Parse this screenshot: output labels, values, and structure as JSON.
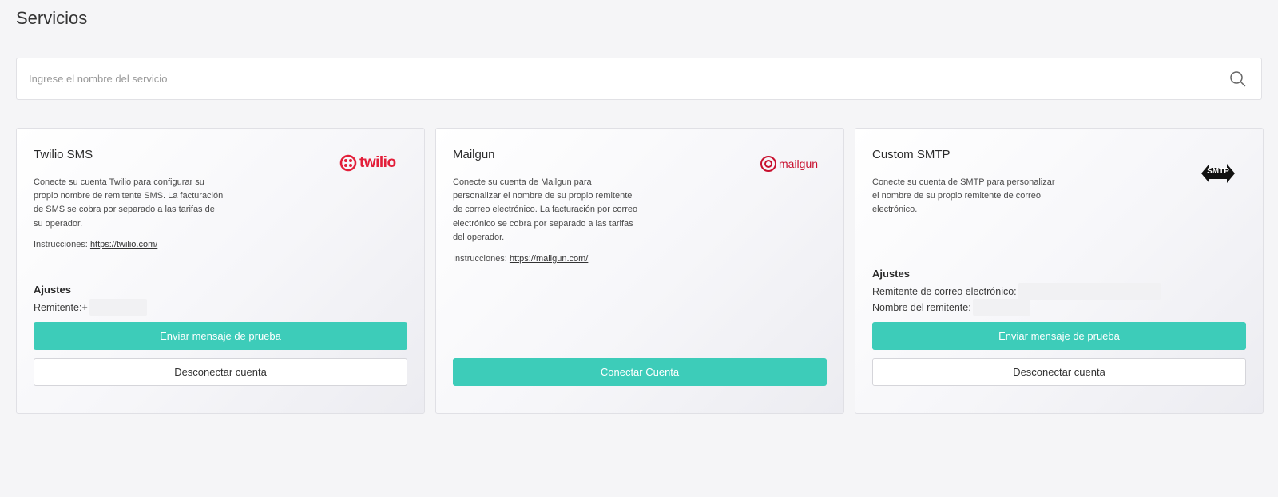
{
  "page": {
    "title": "Servicios"
  },
  "search": {
    "placeholder": "Ingrese el nombre del servicio"
  },
  "colors": {
    "accent": "#3dccb9",
    "twilio": "#e31e39",
    "mailgun": "#c8102e"
  },
  "cards": [
    {
      "title": "Twilio SMS",
      "logo_text": "twilio",
      "logo_icon": "twilio-logo",
      "description": "Conecte su cuenta Twilio para configurar su propio nombre de remitente SMS. La facturación de SMS se cobra por separado a las tarifas de su operador.",
      "instructions_label": "Instrucciones:",
      "instructions_link": "https://twilio.com/",
      "settings_title": "Ajustes",
      "settings": [
        {
          "label": "Remitente:",
          "value": "+"
        }
      ],
      "buttons": [
        "Enviar mensaje de prueba",
        "Desconectar cuenta"
      ]
    },
    {
      "title": "Mailgun",
      "logo_text": "mailgun",
      "logo_icon": "mailgun-logo",
      "description": "Conecte su cuenta de Mailgun para personalizar el nombre de su propio remitente de correo electrónico. La facturación por correo electrónico se cobra por separado a las tarifas del operador.",
      "instructions_label": "Instrucciones:",
      "instructions_link": "https://mailgun.com/",
      "buttons": [
        "Conectar Cuenta"
      ]
    },
    {
      "title": "Custom SMTP",
      "logo_text": "SMTP",
      "logo_icon": "smtp-logo",
      "description": "Conecte su cuenta de SMTP para personalizar el nombre de su propio remitente de correo electrónico.",
      "settings_title": "Ajustes",
      "settings": [
        {
          "label": "Remitente de correo electrónico:"
        },
        {
          "label": "Nombre del remitente:"
        }
      ],
      "buttons": [
        "Enviar mensaje de prueba",
        "Desconectar cuenta"
      ]
    }
  ]
}
